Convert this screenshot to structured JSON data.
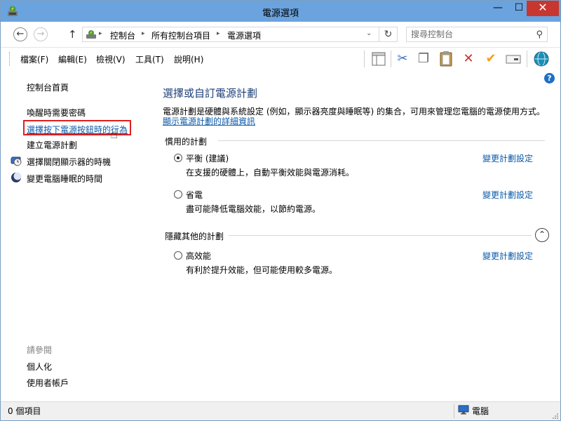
{
  "window": {
    "title": "電源選項",
    "min_glyph": "—",
    "max_glyph": "☐",
    "close_glyph": "✕"
  },
  "nav": {
    "back_glyph": "←",
    "forward_glyph": "→",
    "up_glyph": "↑",
    "refresh_glyph": "↻",
    "dropdown_glyph": "⌄",
    "breadcrumb": [
      "控制台",
      "所有控制台項目",
      "電源選項"
    ],
    "separator": "▸",
    "search_placeholder": "搜尋控制台",
    "search_glyph": "⚲"
  },
  "menu": {
    "items": [
      "檔案(F)",
      "編輯(E)",
      "檢視(V)",
      "工具(T)",
      "說明(H)"
    ]
  },
  "toolbar": {
    "icons": [
      "layout-icon",
      "cut-icon",
      "copy-icon",
      "paste-icon",
      "delete-icon",
      "checkmark-icon",
      "properties-icon",
      "globe-icon"
    ],
    "glyphs": {
      "cut": "✂",
      "copy": "❐",
      "paste": "📋",
      "delete": "✕",
      "check": "✔",
      "properties": "▭"
    },
    "colors": {
      "cut": "#3a6fc4",
      "delete": "#d0312d",
      "check": "#f29f1c",
      "globe": "#1a8fb7"
    }
  },
  "help_glyph": "?",
  "sidebar": {
    "home": "控制台首頁",
    "links": [
      {
        "label": "喚醒時需要密碼",
        "style": "plain"
      },
      {
        "label": "選擇按下電源按鈕時的行為",
        "style": "link",
        "highlighted": true
      },
      {
        "label": "建立電源計劃",
        "style": "plain"
      },
      {
        "label": "選擇關閉顯示器的時機",
        "style": "plain",
        "icon": "display-timer-icon"
      },
      {
        "label": "變更電腦睡眠的時間",
        "style": "plain",
        "icon": "sleep-moon-icon"
      }
    ],
    "see_also_title": "請參閱",
    "see_also": [
      "個人化",
      "使用者帳戶"
    ],
    "highlight_color": "#e02020"
  },
  "main": {
    "title": "選擇或自訂電源計劃",
    "description": "電源計劃是硬體與系統設定 (例如，顯示器亮度與睡眠等) 的集合，可用來管理您電腦的電源使用方式。",
    "details_link": "顯示電源計劃的詳細資訊",
    "preferred_group": "慣用的計劃",
    "hidden_group": "隱藏其他的計劃",
    "collapse_glyph": "⌃",
    "plans": [
      {
        "name": "平衡 (建議)",
        "desc": "在支援的硬體上，自動平衡效能與電源消耗。",
        "selected": true,
        "change": "變更計劃設定"
      },
      {
        "name": "省電",
        "desc": "盡可能降低電腦效能，以節約電源。",
        "selected": false,
        "change": "變更計劃設定"
      },
      {
        "name": "高效能",
        "desc": "有利於提升效能，但可能使用較多電源。",
        "selected": false,
        "change": "變更計劃設定"
      }
    ],
    "title_color": "#1c3e7a",
    "link_color": "#0b5aa8"
  },
  "status": {
    "items_count": "0 個項目",
    "location": "電腦"
  },
  "colors": {
    "titlebar": "#6ba3de",
    "close": "#c7372f"
  }
}
